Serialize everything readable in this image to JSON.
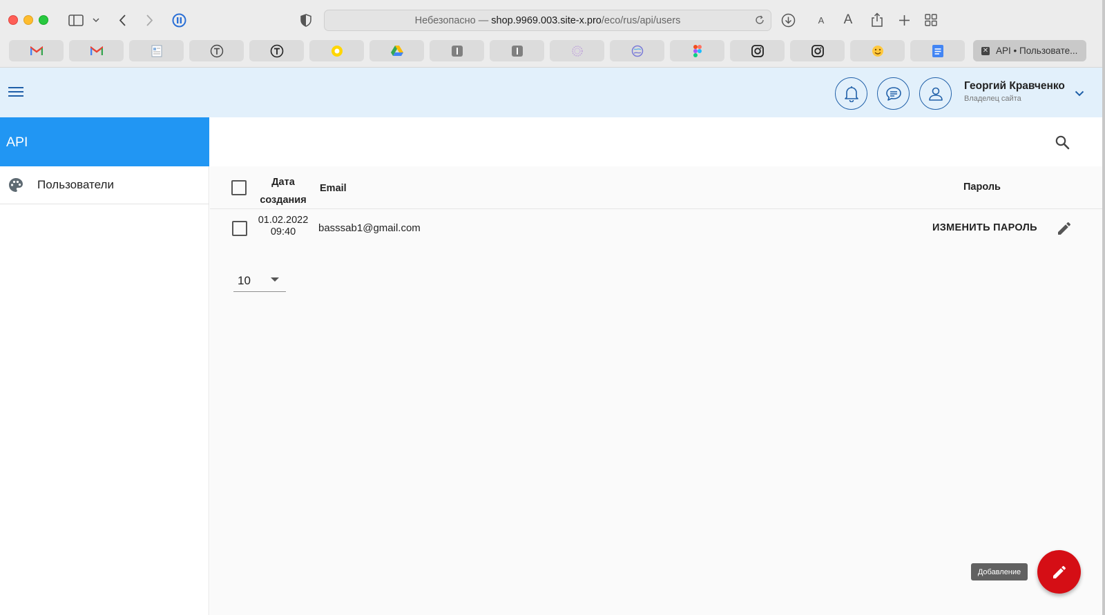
{
  "browser": {
    "url_prefix": "Небезопасно —",
    "url_host": "shop.9969.003.site-x.pro",
    "url_path": "/eco/rus/api/users",
    "active_tab_label": "API • Пользовате...",
    "text_size_small": "A",
    "text_size_large": "A",
    "tab_icons": [
      "gmail-icon",
      "gmail-icon",
      "doc-icon",
      "t-icon",
      "t-icon",
      "yellow-circle-icon",
      "google-drive-icon",
      "i-icon",
      "i-icon",
      "flower-icon",
      "globe-icon",
      "figma-icon",
      "instagram-icon",
      "instagram-icon",
      "smiley-icon",
      "google-docs-icon"
    ]
  },
  "header": {
    "user_name": "Георгий Кравченко",
    "user_role": "Владелец сайта"
  },
  "sidebar": {
    "title": "API",
    "items": [
      {
        "label": "Пользователи",
        "icon": "palette-icon"
      }
    ]
  },
  "table": {
    "columns": {
      "date": "Дата создания",
      "email": "Email",
      "password": "Пароль"
    },
    "rows": [
      {
        "date": "01.02.2022",
        "time": "09:40",
        "email": "basssab1@gmail.com",
        "action": "ИЗМЕНИТЬ ПАРОЛЬ"
      }
    ]
  },
  "pagination": {
    "rows_per_page": "10"
  },
  "fab": {
    "tooltip": "Добавление"
  },
  "colors": {
    "accent": "#2196f3",
    "header_bg": "#e2f0fb",
    "icon_blue": "#1f5fa8",
    "fab": "#d50e15"
  }
}
